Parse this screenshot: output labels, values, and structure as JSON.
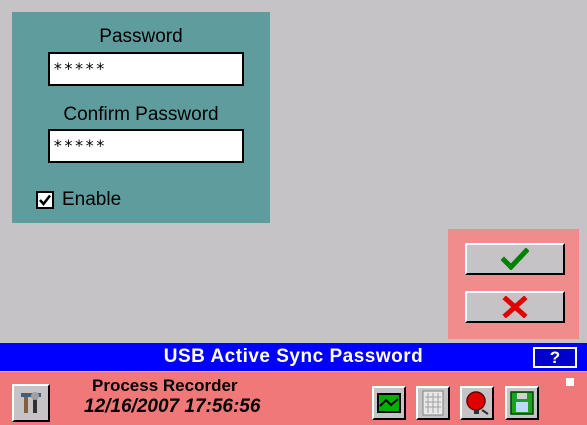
{
  "form": {
    "password_label": "Password",
    "password_value": "*****",
    "confirm_label": "Confirm Password",
    "confirm_value": "*****",
    "enable_label": "Enable",
    "enable_checked": true
  },
  "actions": {
    "ok_icon": "checkmark-icon",
    "cancel_icon": "x-icon"
  },
  "title_bar": {
    "title": "USB Active Sync Password",
    "help_label": "?"
  },
  "status_bar": {
    "recorder_name": "Process Recorder",
    "datetime": "12/16/2007 17:56:56",
    "icons": [
      "tools-icon",
      "chart-icon",
      "grid-icon",
      "alarm-icon",
      "save-icon"
    ]
  },
  "colors": {
    "background": "#c6c3c6",
    "panel": "#5f9c9d",
    "action_box": "#f08c8c",
    "title_bar": "#0000ff",
    "status_bar": "#f07878",
    "ok_green": "#008000",
    "cancel_red": "#e00000"
  }
}
